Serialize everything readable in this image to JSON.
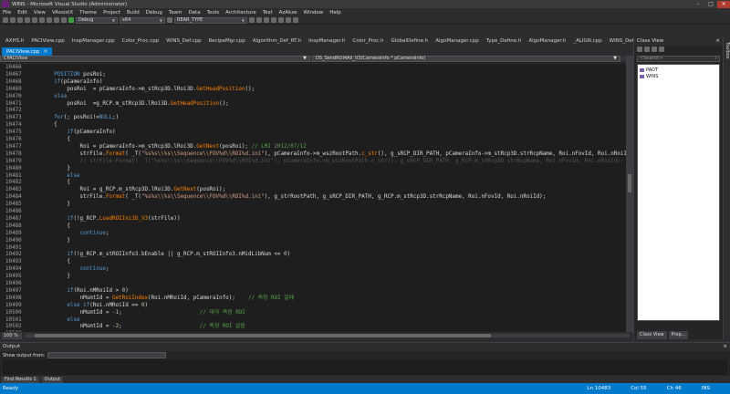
{
  "window": {
    "title": "WINS - Microsoft Visual Studio (Administrator)"
  },
  "menu": [
    "File",
    "Edit",
    "View",
    "VAssistX",
    "Theme",
    "Project",
    "Build",
    "Debug",
    "Team",
    "Data",
    "Tools",
    "Architecture",
    "Test",
    "AzAkze",
    "Window",
    "Help"
  ],
  "toolbar": {
    "config": "Debug",
    "platform": "x64",
    "find_combo": "REAR_TYPE"
  },
  "tabs": [
    {
      "label": "AXHS.h",
      "active": false
    },
    {
      "label": "PACIView.cpp",
      "active": false
    },
    {
      "label": "InspManager.cpp",
      "active": false
    },
    {
      "label": "Color_Proc.cpp",
      "active": false
    },
    {
      "label": "WINS_Def.cpp",
      "active": false
    },
    {
      "label": "RecipeMgr.cpp",
      "active": false
    },
    {
      "label": "Algorithm_Def_RT.h",
      "active": false
    },
    {
      "label": "InspManager.h",
      "active": false
    },
    {
      "label": "Color_Proc.h",
      "active": false
    },
    {
      "label": "GlobalDefine.h",
      "active": false
    },
    {
      "label": "AlgoManager.cpp",
      "active": false
    },
    {
      "label": "Type_Define.h",
      "active": false
    },
    {
      "label": "AlgoManager.h",
      "active": false
    },
    {
      "label": "_ALIGN.cpp",
      "active": false
    },
    {
      "label": "WINS_Def.h",
      "active": false
    }
  ],
  "file_tab": {
    "label": "PACIView.cpp",
    "close": "×"
  },
  "navbar": {
    "scope": "CPACIView",
    "member": "DS_SendROI4All_V3(CameraInfo * pCameraInfo)"
  },
  "editor": {
    "lines": [
      {
        "n": "10466",
        "c": ""
      },
      {
        "n": "10467",
        "c": "    POSITION posRoi;"
      },
      {
        "n": "10468",
        "c": "    if(pCameraInfo)"
      },
      {
        "n": "10469",
        "c": "        posRoi  = pCameraInfo->m_stRcp3D.lRoi3D.GetHeadPosition();"
      },
      {
        "n": "10470",
        "c": "    else"
      },
      {
        "n": "10471",
        "c": "        posRoi  =g_RCP.m_stRcp3D.lRoi3D.GetHeadPosition();"
      },
      {
        "n": "10472",
        "c": ""
      },
      {
        "n": "10473",
        "c": "    for(; posRoi!=NULL;)"
      },
      {
        "n": "10474",
        "c": "    {"
      },
      {
        "n": "10475",
        "c": "        if(pCameraInfo)"
      },
      {
        "n": "10476",
        "c": "        {"
      },
      {
        "n": "10477",
        "c": "            Roi = pCameraInfo->m_stRcp3D.lRoi3D.GetNext(posRoi); // LMJ 2012/07/12"
      },
      {
        "n": "10478",
        "c": "            strFile.Format( _T(\"%s%s\\\\%s\\\\Sequence\\\\FOV%d\\\\ROI%d.ini\"), pCameraInfo->m_wszRootPath.c_str(), g_sRCP_DIR_PATH, pCameraInfo->m_stRcp3D.strRcpName, Roi.nFovId, Roi.nRoiId);"
      },
      {
        "n": "10479",
        "c": "            // strFile.Format( _T(\"%s%s\\\\%s\\\\Sequence\\\\FOV%d\\\\ROI%d.ini\"), pCameraInfo->m_wszRootPath.c_str(), g_sRCP_DIR_PATH, g_RCP.m_stRcp3D.strRcpName, Roi.nFovId, Roi.nRoiId);"
      },
      {
        "n": "10480",
        "c": "        }"
      },
      {
        "n": "10481",
        "c": "        else"
      },
      {
        "n": "10482",
        "c": "        {"
      },
      {
        "n": "10483",
        "c": "            Roi = g_RCP.m_stRcp3D.lRoi3D.GetNext(posRoi);"
      },
      {
        "n": "10484",
        "c": "            strFile.Format( _T(\"%s%s\\\\%s\\\\Sequence\\\\FOV%d\\\\ROI%d.ini\"), g_strRootPath, g_sRCP_DIR_PATH, g_RCP.m_stRcp3D.strRcpName, Roi.nFovId, Roi.nRoiId);"
      },
      {
        "n": "10485",
        "c": "        }"
      },
      {
        "n": "10486",
        "c": ""
      },
      {
        "n": "10487",
        "c": "        if(!g_RCP.LoadROIIni3D_V3(strFile))"
      },
      {
        "n": "10488",
        "c": "        {"
      },
      {
        "n": "10489",
        "c": "            continue;"
      },
      {
        "n": "10490",
        "c": "        }"
      },
      {
        "n": "10491",
        "c": ""
      },
      {
        "n": "10492",
        "c": "        if(!g_RCP.m_stROIInfo3.bEnable || g_RCP.m_stROIInfo3.nMidLibNum <= 0)"
      },
      {
        "n": "10493",
        "c": "        {"
      },
      {
        "n": "10494",
        "c": "            continue;"
      },
      {
        "n": "10495",
        "c": "        }"
      },
      {
        "n": "10496",
        "c": ""
      },
      {
        "n": "10497",
        "c": "        if(Roi.nMRoiId > 0)"
      },
      {
        "n": "10498",
        "c": "            nMsmtId = GetRoiIndex(Roi.nMRoiId, pCameraInfo);    // 측정 ROI 일때"
      },
      {
        "n": "10499",
        "c": "        else if(Roi.nMRoiId == 0)"
      },
      {
        "n": "10500",
        "c": "            nMsmtId = -1;                        // 대각 측정 ROI"
      },
      {
        "n": "10501",
        "c": "        else"
      },
      {
        "n": "10502",
        "c": "            nMsmtId = -2;                        // 측정 ROI 없음"
      },
      {
        "n": "10503",
        "c": ""
      }
    ]
  },
  "zoom": "100 %",
  "class_view": {
    "title": "Class View",
    "search_placeholder": "<Search>",
    "items": [
      "PAOT",
      "WINS"
    ],
    "bottom_tabs": [
      "Class View",
      "Prop..."
    ]
  },
  "toolbox_label": "Toolbox",
  "output": {
    "title": "Output",
    "show_output_from": "Show output from:"
  },
  "output_tabs": [
    "Find Results 1",
    "Output"
  ],
  "status": {
    "ready": "Ready",
    "line": "Ln 10483",
    "col": "Col 55",
    "ch": "Ch 46",
    "mode": "INS"
  },
  "colors": {
    "accent": "#007acc",
    "bg": "#1e1e1e",
    "keyword": "#569cd6",
    "string": "#d69d85",
    "comment": "#57a64a"
  }
}
